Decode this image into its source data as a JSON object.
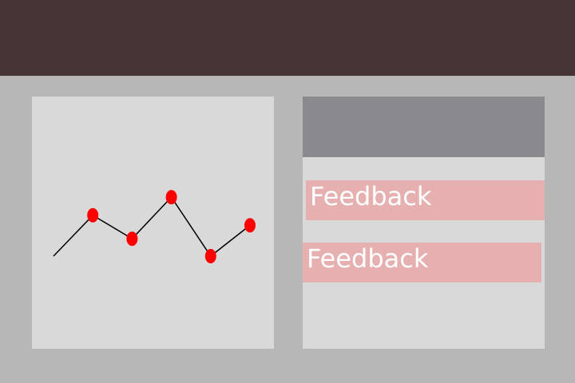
{
  "colors": {
    "top_bar": "#473535",
    "background": "#b7b7b7",
    "panel": "#d9d9d9",
    "panel_header": "#8a8a8e",
    "feedback_background": "#e6b0b0",
    "feedback_text": "#ffffff",
    "line": "#000000",
    "marker": "#ff0000"
  },
  "feedback": {
    "items": [
      {
        "label": "Feedback"
      },
      {
        "label": "Feedback"
      }
    ]
  },
  "chart_data": {
    "type": "line",
    "x": [
      0,
      1,
      2,
      3,
      4,
      5
    ],
    "y": [
      0.0,
      0.61,
      0.26,
      0.88,
      0.0,
      0.46
    ],
    "ylim": [
      0,
      1
    ],
    "markers_on_points": [
      1,
      2,
      3,
      4,
      5
    ],
    "title": "",
    "xlabel": "",
    "ylabel": "",
    "grid": false,
    "legend": "none"
  }
}
